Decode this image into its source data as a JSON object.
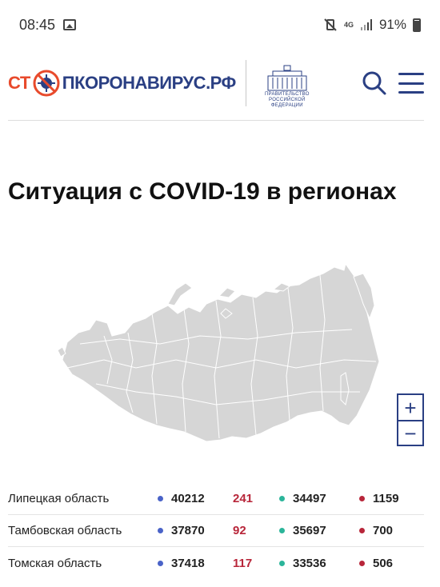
{
  "status_bar": {
    "time": "08:45",
    "network": "4G",
    "battery": "91%"
  },
  "header": {
    "logo_part1": "СТ",
    "logo_part2": "ПКОРОНАВИРУС.РФ",
    "gov_line1": "ПРАВИТЕЛЬСТВО",
    "gov_line2": "РОССИЙСКОЙ",
    "gov_line3": "ФЕДЕРАЦИИ"
  },
  "page": {
    "title": "Ситуация с COVID-19 в регионах"
  },
  "map": {
    "zoom_in": "+",
    "zoom_out": "−"
  },
  "colors": {
    "total_dot": "#4a63c8",
    "new_text": "#b8263a",
    "recovered_dot": "#2bb59a",
    "deaths_dot": "#b8263a"
  },
  "regions": [
    {
      "name": "Липецкая область",
      "total": "40212",
      "new": "241",
      "recovered": "34497",
      "deaths": "1159"
    },
    {
      "name": "Тамбовская область",
      "total": "37870",
      "new": "92",
      "recovered": "35697",
      "deaths": "700"
    },
    {
      "name": "Томская область",
      "total": "37418",
      "new": "117",
      "recovered": "33536",
      "deaths": "506"
    }
  ]
}
